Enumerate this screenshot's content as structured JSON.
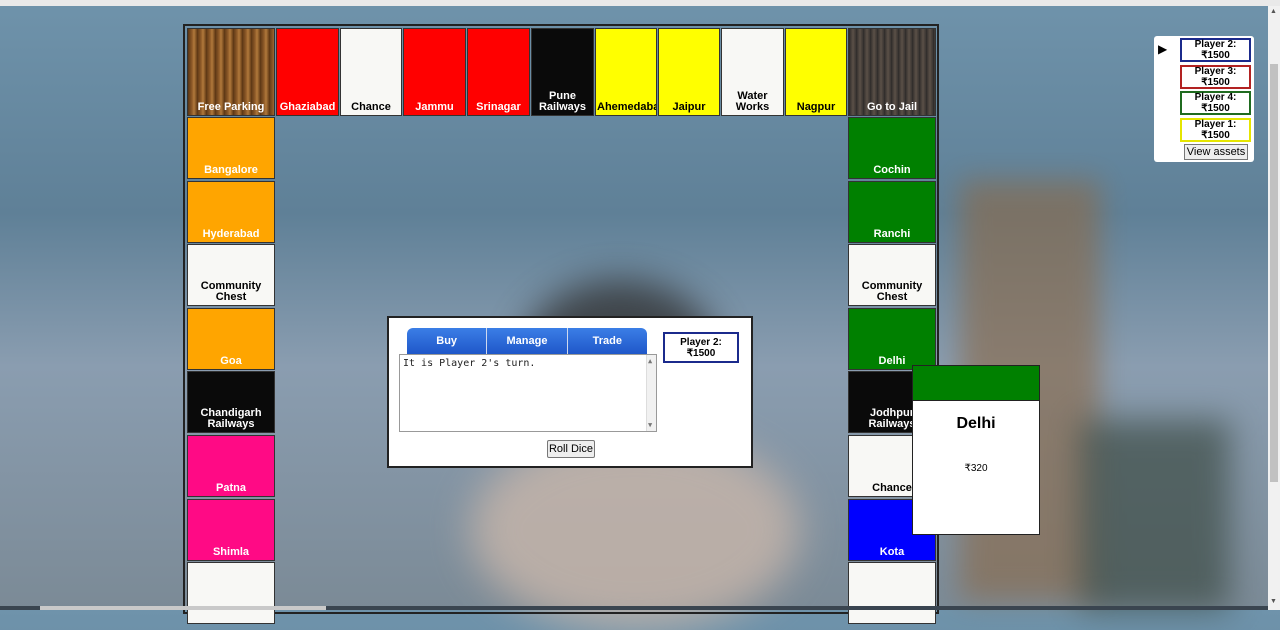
{
  "board": {
    "top_row": [
      {
        "name": "Free Parking",
        "color": "wood"
      },
      {
        "name": "Ghaziabad",
        "color": "#ff0000"
      },
      {
        "name": "Chance",
        "color": "#f8f8f5"
      },
      {
        "name": "Jammu",
        "color": "#ff0000"
      },
      {
        "name": "Srinagar",
        "color": "#ff0000"
      },
      {
        "name": "Pune Railways",
        "color": "#0a0a0a"
      },
      {
        "name": "Ahemedabad",
        "color": "#ffff00"
      },
      {
        "name": "Jaipur",
        "color": "#ffff00"
      },
      {
        "name": "Water Works",
        "color": "#f8f8f5"
      },
      {
        "name": "Nagpur",
        "color": "#ffff00"
      },
      {
        "name": "Go to Jail",
        "color": "wood2"
      }
    ],
    "left_col": [
      {
        "name": "Bangalore",
        "color": "#ffa500"
      },
      {
        "name": "Hyderabad",
        "color": "#ffa500"
      },
      {
        "name": "Community Chest",
        "color": "#f8f8f5"
      },
      {
        "name": "Goa",
        "color": "#ffa500"
      },
      {
        "name": "Chandigarh Railways",
        "color": "#0a0a0a"
      },
      {
        "name": "Patna",
        "color": "#ff0a85"
      },
      {
        "name": "Shimla",
        "color": "#ff0a85"
      },
      {
        "name": "",
        "color": "#f8f8f5"
      }
    ],
    "right_col": [
      {
        "name": "Cochin",
        "color": "#008000"
      },
      {
        "name": "Ranchi",
        "color": "#008000"
      },
      {
        "name": "Community Chest",
        "color": "#f8f8f5"
      },
      {
        "name": "Delhi",
        "color": "#008000"
      },
      {
        "name": "Jodhpur Railways",
        "color": "#0a0a0a"
      },
      {
        "name": "Chance",
        "color": "#f8f8f5"
      },
      {
        "name": "Kota",
        "color": "#0000ff"
      },
      {
        "name": "",
        "color": "#f8f8f5"
      }
    ]
  },
  "control": {
    "tabs": [
      "Buy",
      "Manage",
      "Trade"
    ],
    "message": "It is Player 2's turn.",
    "current_player": {
      "name": "Player 2:",
      "money": "₹1500",
      "color": "#1b2a8c"
    },
    "roll_label": "Roll Dice"
  },
  "card": {
    "title": "Delhi",
    "price": "₹320",
    "color": "#008000"
  },
  "players": {
    "turn_marker": "▶",
    "list": [
      {
        "name": "Player 2:",
        "money": "₹1500",
        "color": "#1b2a8c"
      },
      {
        "name": "Player 3:",
        "money": "₹1500",
        "color": "#b22222"
      },
      {
        "name": "Player 4:",
        "money": "₹1500",
        "color": "#1f6b1f"
      },
      {
        "name": "Player 1:",
        "money": "₹1500",
        "color": "#e5e500"
      }
    ],
    "assets_label": "View assets"
  }
}
